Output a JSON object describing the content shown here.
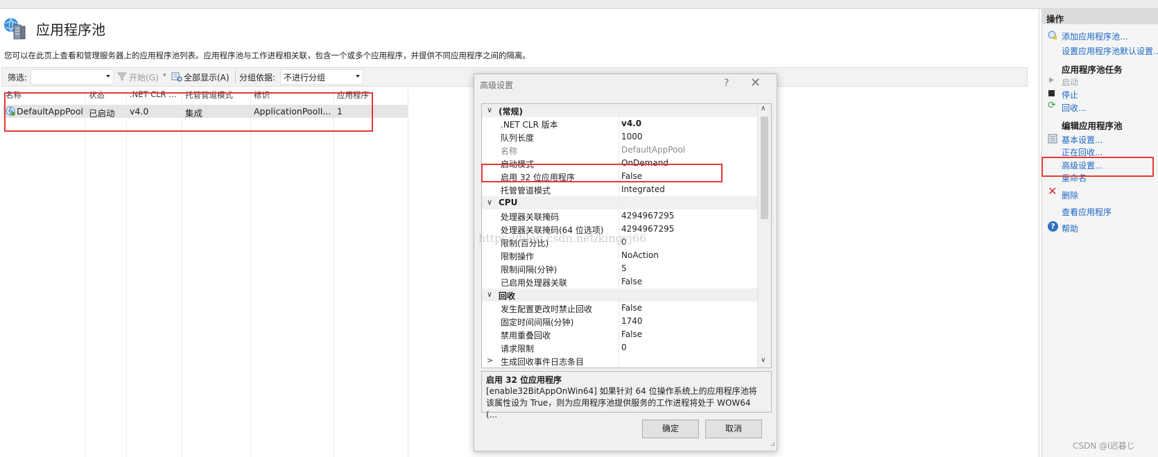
{
  "page": {
    "title": "应用程序池",
    "description": "您可以在此页上查看和管理服务器上的应用程序池列表。应用程序池与工作进程相关联，包含一个或多个应用程序，并提供不同应用程序之间的隔离。"
  },
  "toolbar": {
    "filter_label": "筛选:",
    "filter_value": "",
    "start_label": "开始(G)",
    "show_all_label": "全部显示(A)",
    "group_label": "分组依据:",
    "group_value": "不进行分组"
  },
  "table": {
    "headers": [
      "名称",
      "状态",
      ".NET CLR ...",
      "托管管道模式",
      "标识",
      "应用程序"
    ],
    "rows": [
      {
        "name": "DefaultAppPool",
        "status": "已启动",
        "clr": "v4.0",
        "pipeline": "集成",
        "identity": "ApplicationPoolI...",
        "apps": "1"
      }
    ]
  },
  "actions": {
    "header": "操作",
    "add_pool": "添加应用程序池...",
    "set_defaults": "设置应用程序池默认设置...",
    "tasks_section": "应用程序池任务",
    "start": "启动",
    "stop": "停止",
    "recycle": "回收...",
    "edit_section": "编辑应用程序池",
    "basic": "基本设置...",
    "recycling": "正在回收...",
    "advanced": "高级设置...",
    "rename": "重命名",
    "delete": "删除",
    "view_apps": "查看应用程序",
    "help": "帮助"
  },
  "dialog": {
    "title": "高级设置",
    "help_glyph": "?",
    "close_glyph": "✕",
    "grid": [
      {
        "type": "cat",
        "name": "(常规)",
        "expander": "∨"
      },
      {
        "type": "prop",
        "name": ".NET CLR 版本",
        "value": "v4.0",
        "style": "bold"
      },
      {
        "type": "prop",
        "name": "队列长度",
        "value": "1000"
      },
      {
        "type": "prop",
        "name": "名称",
        "value": "DefaultAppPool",
        "style": "gray"
      },
      {
        "type": "prop",
        "name": "启动模式",
        "value": "OnDemand"
      },
      {
        "type": "prop",
        "name": "启用 32 位应用程序",
        "value": "False"
      },
      {
        "type": "prop",
        "name": "托管管道模式",
        "value": "Integrated"
      },
      {
        "type": "cat",
        "name": "CPU",
        "expander": "∨"
      },
      {
        "type": "prop",
        "name": "处理器关联掩码",
        "value": "4294967295"
      },
      {
        "type": "prop",
        "name": "处理器关联掩码(64 位选项)",
        "value": "4294967295"
      },
      {
        "type": "prop",
        "name": "限制(百分比)",
        "value": "0"
      },
      {
        "type": "prop",
        "name": "限制操作",
        "value": "NoAction"
      },
      {
        "type": "prop",
        "name": "限制间隔(分钟)",
        "value": "5"
      },
      {
        "type": "prop",
        "name": "已启用处理器关联",
        "value": "False"
      },
      {
        "type": "cat",
        "name": "回收",
        "expander": "∨"
      },
      {
        "type": "prop",
        "name": "发生配置更改时禁止回收",
        "value": "False"
      },
      {
        "type": "prop",
        "name": "固定时间间隔(分钟)",
        "value": "1740"
      },
      {
        "type": "prop",
        "name": "禁用重叠回收",
        "value": "False"
      },
      {
        "type": "prop",
        "name": "请求限制",
        "value": "0"
      },
      {
        "type": "prop",
        "name": "生成回收事件日志条目",
        "value": "",
        "expander": ">"
      }
    ],
    "desc_title": "启用 32 位应用程序",
    "desc_text": "[enable32BitAppOnWin64] 如果针对 64 位操作系统上的应用程序池将该属性设为 True，则为应用程序池提供服务的工作进程将处于 WOW64 (...",
    "ok": "确定",
    "cancel": "取消"
  },
  "watermark": "https://blog.csdn.net/kingyj66",
  "csdn_badge": "CSDN @I迟暮じ"
}
